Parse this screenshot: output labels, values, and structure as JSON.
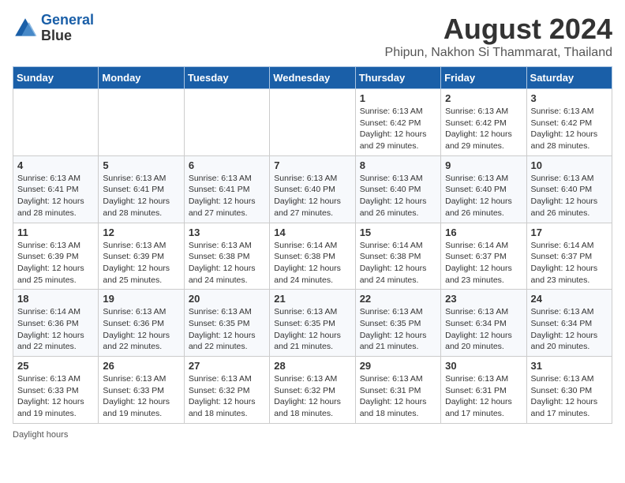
{
  "logo": {
    "line1": "General",
    "line2": "Blue"
  },
  "title": "August 2024",
  "subtitle": "Phipun, Nakhon Si Thammarat, Thailand",
  "days_header": [
    "Sunday",
    "Monday",
    "Tuesday",
    "Wednesday",
    "Thursday",
    "Friday",
    "Saturday"
  ],
  "footer": "Daylight hours",
  "weeks": [
    [
      {
        "day": "",
        "info": ""
      },
      {
        "day": "",
        "info": ""
      },
      {
        "day": "",
        "info": ""
      },
      {
        "day": "",
        "info": ""
      },
      {
        "day": "1",
        "info": "Sunrise: 6:13 AM\nSunset: 6:42 PM\nDaylight: 12 hours\nand 29 minutes."
      },
      {
        "day": "2",
        "info": "Sunrise: 6:13 AM\nSunset: 6:42 PM\nDaylight: 12 hours\nand 29 minutes."
      },
      {
        "day": "3",
        "info": "Sunrise: 6:13 AM\nSunset: 6:42 PM\nDaylight: 12 hours\nand 28 minutes."
      }
    ],
    [
      {
        "day": "4",
        "info": "Sunrise: 6:13 AM\nSunset: 6:41 PM\nDaylight: 12 hours\nand 28 minutes."
      },
      {
        "day": "5",
        "info": "Sunrise: 6:13 AM\nSunset: 6:41 PM\nDaylight: 12 hours\nand 28 minutes."
      },
      {
        "day": "6",
        "info": "Sunrise: 6:13 AM\nSunset: 6:41 PM\nDaylight: 12 hours\nand 27 minutes."
      },
      {
        "day": "7",
        "info": "Sunrise: 6:13 AM\nSunset: 6:40 PM\nDaylight: 12 hours\nand 27 minutes."
      },
      {
        "day": "8",
        "info": "Sunrise: 6:13 AM\nSunset: 6:40 PM\nDaylight: 12 hours\nand 26 minutes."
      },
      {
        "day": "9",
        "info": "Sunrise: 6:13 AM\nSunset: 6:40 PM\nDaylight: 12 hours\nand 26 minutes."
      },
      {
        "day": "10",
        "info": "Sunrise: 6:13 AM\nSunset: 6:40 PM\nDaylight: 12 hours\nand 26 minutes."
      }
    ],
    [
      {
        "day": "11",
        "info": "Sunrise: 6:13 AM\nSunset: 6:39 PM\nDaylight: 12 hours\nand 25 minutes."
      },
      {
        "day": "12",
        "info": "Sunrise: 6:13 AM\nSunset: 6:39 PM\nDaylight: 12 hours\nand 25 minutes."
      },
      {
        "day": "13",
        "info": "Sunrise: 6:13 AM\nSunset: 6:38 PM\nDaylight: 12 hours\nand 24 minutes."
      },
      {
        "day": "14",
        "info": "Sunrise: 6:14 AM\nSunset: 6:38 PM\nDaylight: 12 hours\nand 24 minutes."
      },
      {
        "day": "15",
        "info": "Sunrise: 6:14 AM\nSunset: 6:38 PM\nDaylight: 12 hours\nand 24 minutes."
      },
      {
        "day": "16",
        "info": "Sunrise: 6:14 AM\nSunset: 6:37 PM\nDaylight: 12 hours\nand 23 minutes."
      },
      {
        "day": "17",
        "info": "Sunrise: 6:14 AM\nSunset: 6:37 PM\nDaylight: 12 hours\nand 23 minutes."
      }
    ],
    [
      {
        "day": "18",
        "info": "Sunrise: 6:14 AM\nSunset: 6:36 PM\nDaylight: 12 hours\nand 22 minutes."
      },
      {
        "day": "19",
        "info": "Sunrise: 6:13 AM\nSunset: 6:36 PM\nDaylight: 12 hours\nand 22 minutes."
      },
      {
        "day": "20",
        "info": "Sunrise: 6:13 AM\nSunset: 6:35 PM\nDaylight: 12 hours\nand 22 minutes."
      },
      {
        "day": "21",
        "info": "Sunrise: 6:13 AM\nSunset: 6:35 PM\nDaylight: 12 hours\nand 21 minutes."
      },
      {
        "day": "22",
        "info": "Sunrise: 6:13 AM\nSunset: 6:35 PM\nDaylight: 12 hours\nand 21 minutes."
      },
      {
        "day": "23",
        "info": "Sunrise: 6:13 AM\nSunset: 6:34 PM\nDaylight: 12 hours\nand 20 minutes."
      },
      {
        "day": "24",
        "info": "Sunrise: 6:13 AM\nSunset: 6:34 PM\nDaylight: 12 hours\nand 20 minutes."
      }
    ],
    [
      {
        "day": "25",
        "info": "Sunrise: 6:13 AM\nSunset: 6:33 PM\nDaylight: 12 hours\nand 19 minutes."
      },
      {
        "day": "26",
        "info": "Sunrise: 6:13 AM\nSunset: 6:33 PM\nDaylight: 12 hours\nand 19 minutes."
      },
      {
        "day": "27",
        "info": "Sunrise: 6:13 AM\nSunset: 6:32 PM\nDaylight: 12 hours\nand 18 minutes."
      },
      {
        "day": "28",
        "info": "Sunrise: 6:13 AM\nSunset: 6:32 PM\nDaylight: 12 hours\nand 18 minutes."
      },
      {
        "day": "29",
        "info": "Sunrise: 6:13 AM\nSunset: 6:31 PM\nDaylight: 12 hours\nand 18 minutes."
      },
      {
        "day": "30",
        "info": "Sunrise: 6:13 AM\nSunset: 6:31 PM\nDaylight: 12 hours\nand 17 minutes."
      },
      {
        "day": "31",
        "info": "Sunrise: 6:13 AM\nSunset: 6:30 PM\nDaylight: 12 hours\nand 17 minutes."
      }
    ]
  ]
}
